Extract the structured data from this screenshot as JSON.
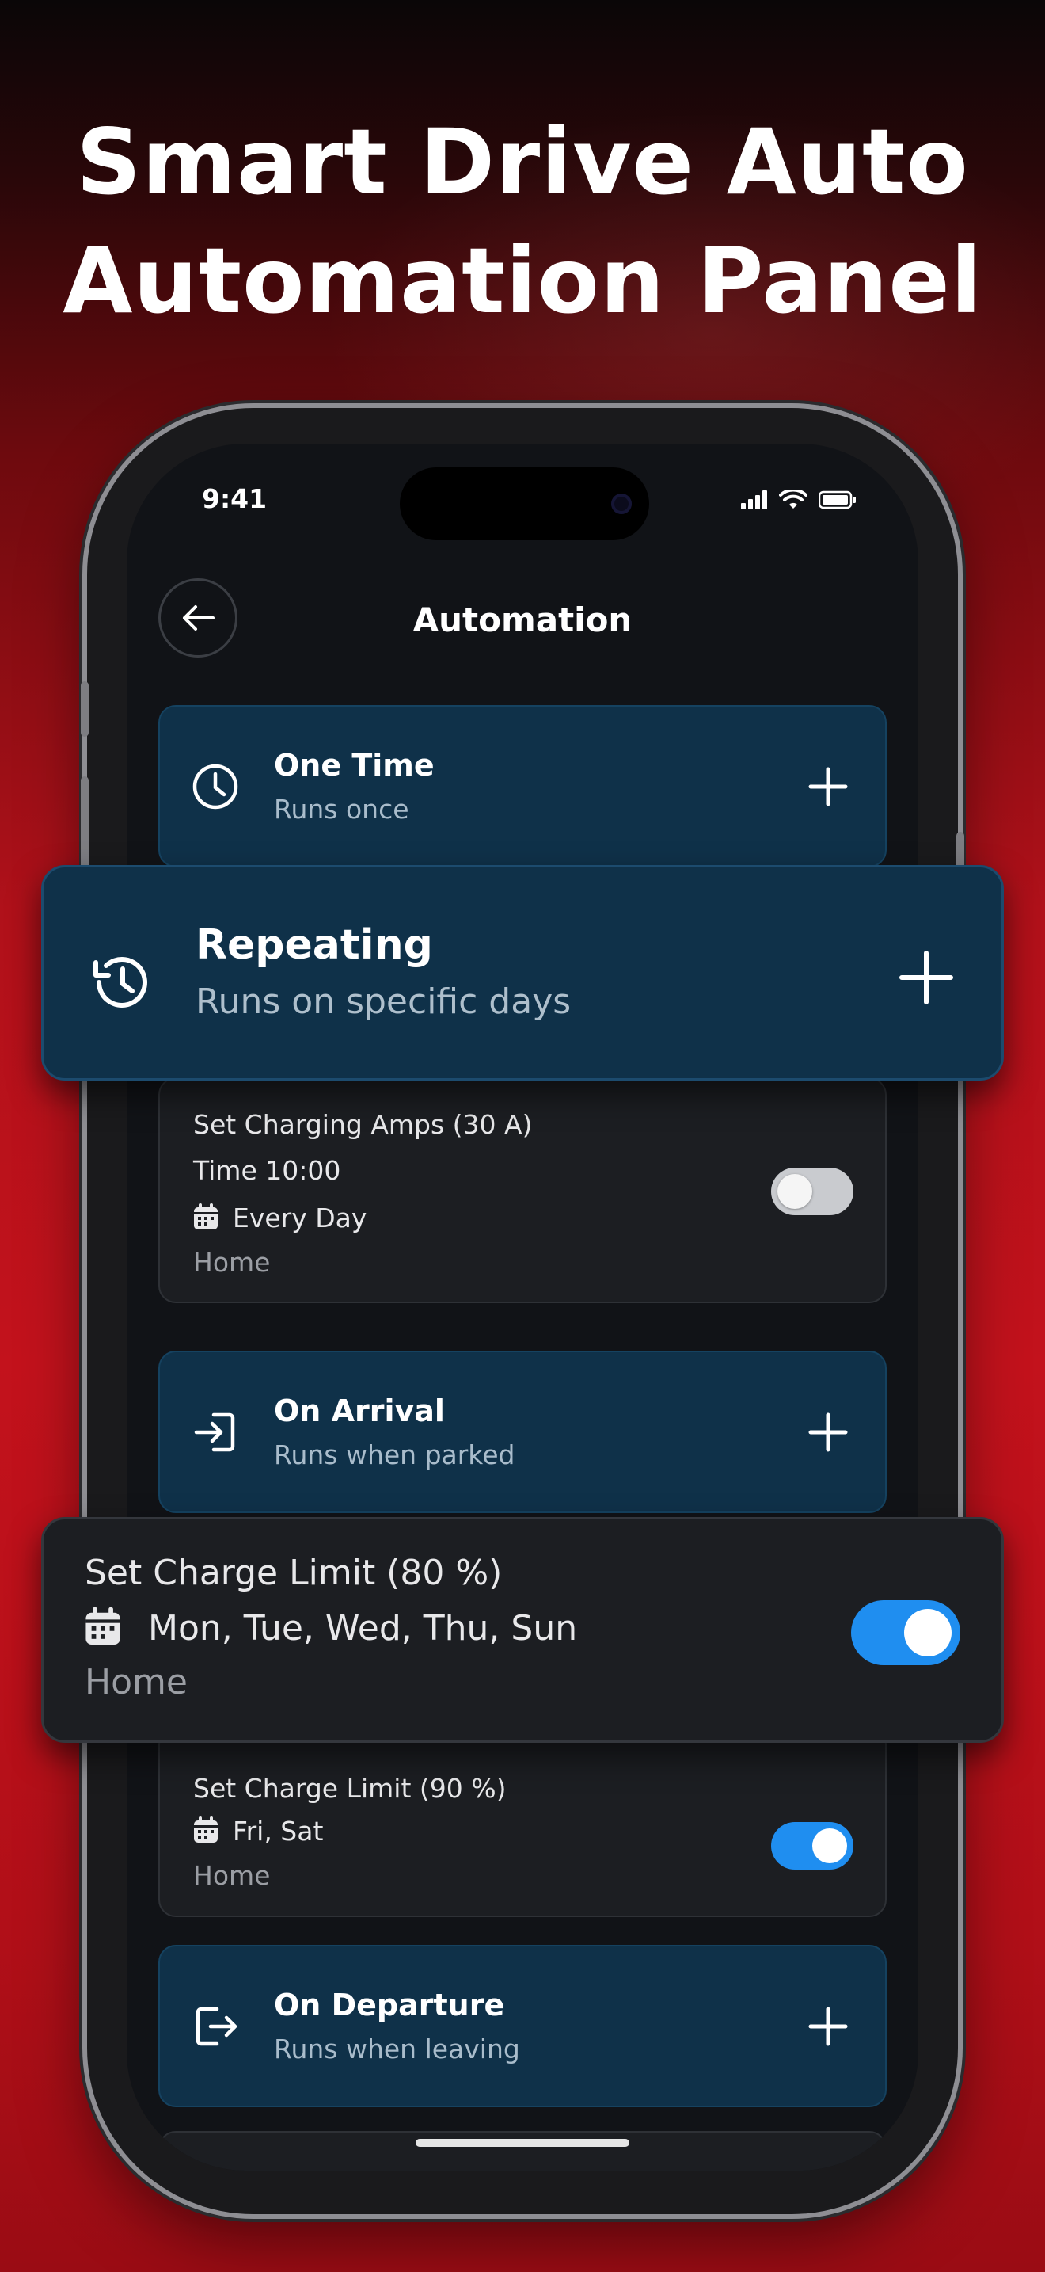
{
  "promo": {
    "headline_line1": "Smart Drive Auto",
    "headline_line2": "Automation Panel"
  },
  "status_bar": {
    "time": "9:41"
  },
  "header": {
    "title": "Automation"
  },
  "sections": {
    "one_time": {
      "title": "One Time",
      "subtitle": "Runs once"
    },
    "repeating": {
      "title": "Repeating",
      "subtitle": "Runs on specific days"
    },
    "on_arrival": {
      "title": "On Arrival",
      "subtitle": "Runs when parked"
    },
    "on_departure": {
      "title": "On Departure",
      "subtitle": "Runs when leaving"
    }
  },
  "rules": [
    {
      "title": "Set Charging Amps (30 A)",
      "time": "Time 10:00",
      "days": "Every Day",
      "location": "Home",
      "enabled": false
    },
    {
      "title": "Set Charge Limit (80 %)",
      "days": "Mon, Tue, Wed, Thu, Sun",
      "location": "Home",
      "enabled": true
    },
    {
      "title": "Set Charge Limit (90 %)",
      "days": "Fri, Sat",
      "location": "Home",
      "enabled": true
    }
  ],
  "colors": {
    "accent": "#1f8ef0",
    "card_blue": "#0f3149",
    "card_dark": "#1c1e22",
    "background_red": "#c3121c"
  },
  "icons": [
    "back-arrow-icon",
    "clock-icon",
    "history-icon",
    "arrival-icon",
    "departure-icon",
    "plus-icon",
    "calendar-icon",
    "signal-icon",
    "wifi-icon",
    "battery-icon"
  ]
}
